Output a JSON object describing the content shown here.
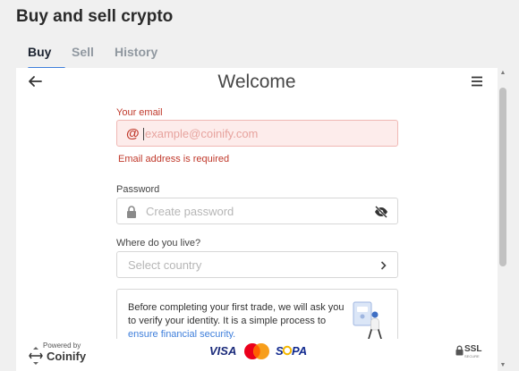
{
  "page": {
    "title": "Buy and sell crypto"
  },
  "tabs": [
    {
      "label": "Buy",
      "active": true
    },
    {
      "label": "Sell",
      "active": false
    },
    {
      "label": "History",
      "active": false
    }
  ],
  "widget": {
    "heading": "Welcome",
    "back_icon": "arrow-left-icon",
    "menu_icon": "hamburger-menu-icon",
    "email": {
      "label": "Your email",
      "placeholder": "example@coinify.com",
      "value": "",
      "error": "Email address is required",
      "icon": "at-sign-icon"
    },
    "password": {
      "label": "Password",
      "placeholder": "Create password",
      "value": "",
      "icon": "lock-icon",
      "toggle_icon": "eye-slash-icon"
    },
    "country": {
      "label": "Where do you live?",
      "placeholder": "Select country",
      "icon": "chevron-right-icon"
    },
    "info": {
      "lines": [
        "Before completing your first trade, we will ask you",
        "to verify your identity. It is a simple process to"
      ],
      "link": "ensure financial security."
    }
  },
  "footer": {
    "powered_by": "Powered by",
    "brand": "Coinify",
    "payments": [
      "VISA",
      "Mastercard",
      "SEPA"
    ],
    "ssl": "SSL",
    "ssl_sub": "SECURE"
  },
  "colors": {
    "accent": "#3f7fdb",
    "error": "#c0392b",
    "error_bg": "#fdeceb",
    "error_border": "#f0b8b4"
  }
}
